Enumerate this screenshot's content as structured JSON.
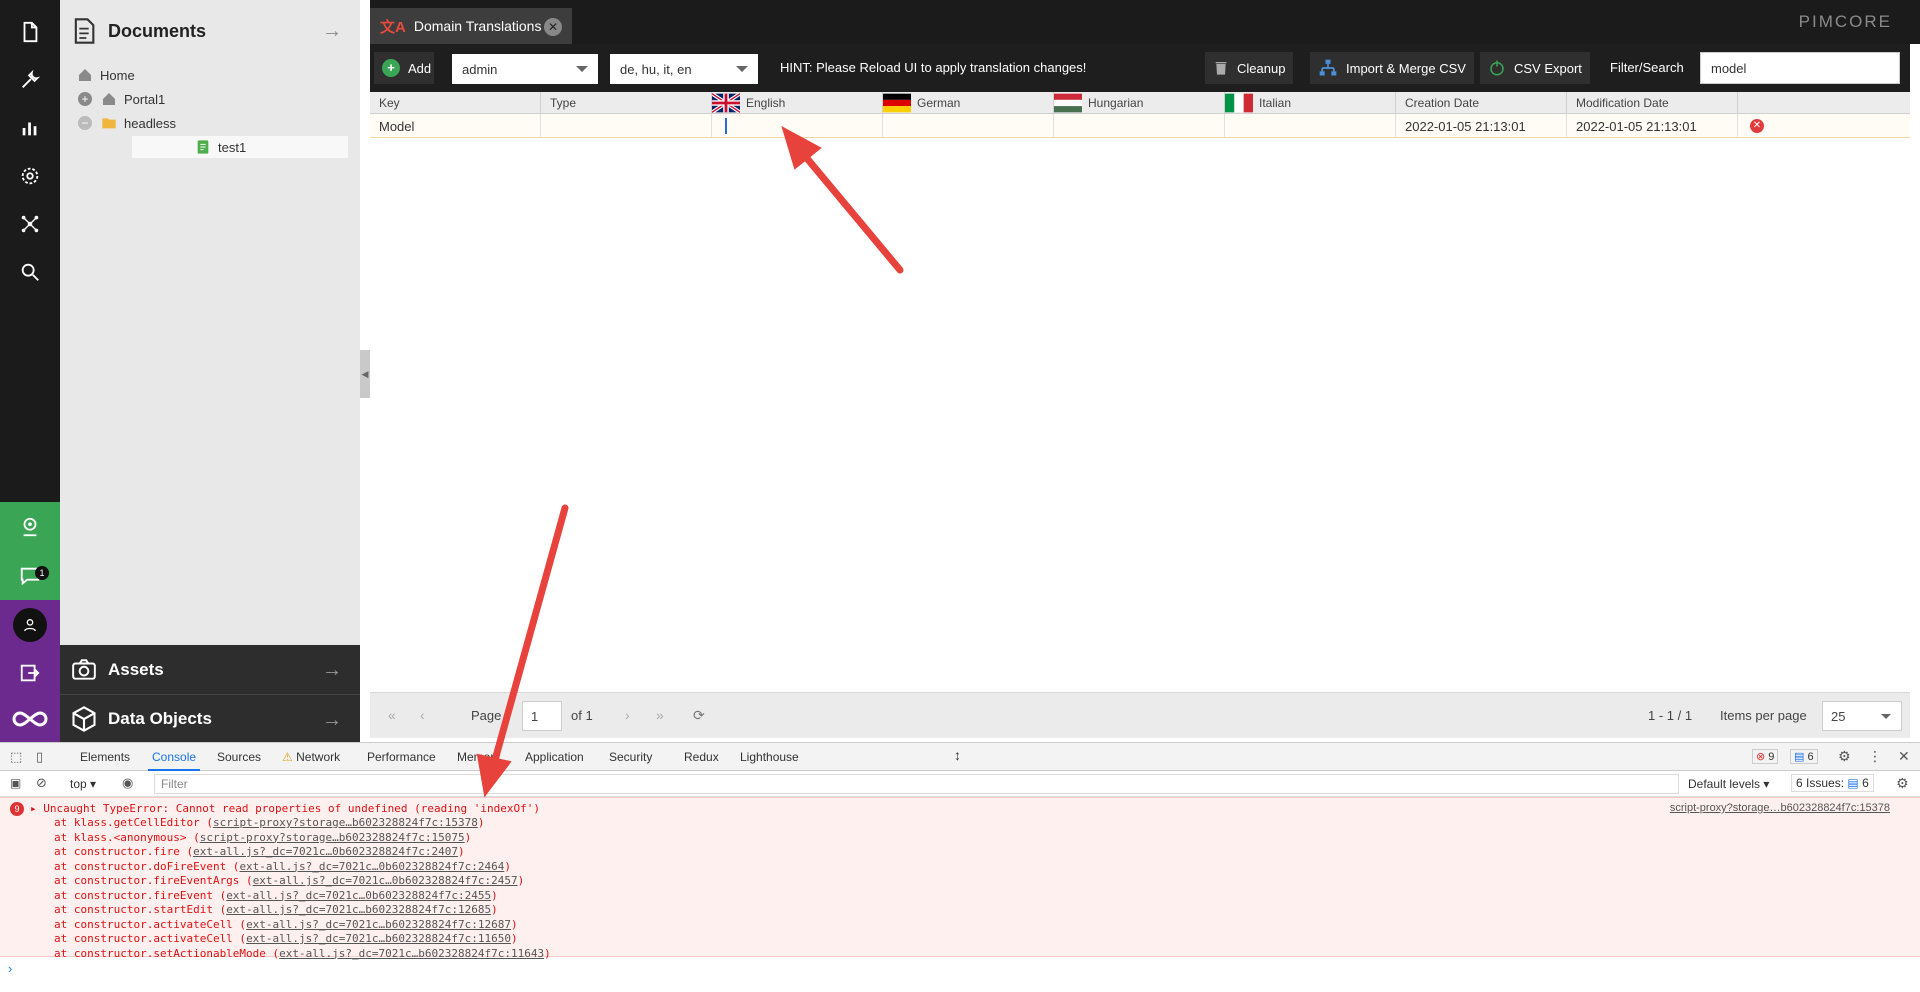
{
  "documents_panel": {
    "title": "Documents",
    "tree": [
      {
        "label": "Home"
      },
      {
        "label": "Portal1"
      },
      {
        "label": "headless"
      },
      {
        "label": "test1"
      }
    ]
  },
  "side_tabs": {
    "assets": "Assets",
    "data_objects": "Data Objects"
  },
  "iconbar": {
    "chat_badge": "1"
  },
  "tab": {
    "label": "Domain Translations"
  },
  "brand": {
    "logo": "PIMCORE"
  },
  "toolbar": {
    "add": "Add",
    "domain_value": "admin",
    "languages_value": "de, hu, it, en",
    "hint": "HINT: Please Reload UI to apply translation changes!",
    "cleanup": "Cleanup",
    "import": "Import & Merge CSV",
    "export": "CSV Export",
    "filter_label": "Filter/Search",
    "filter_value": "model"
  },
  "grid": {
    "columns": [
      "Key",
      "Type",
      "English",
      "German",
      "Hungarian",
      "Italian",
      "Creation Date",
      "Modification Date"
    ],
    "rows": [
      {
        "key": "Model",
        "type": "",
        "english": "",
        "german": "",
        "hungarian": "",
        "italian": "",
        "creation": "2022-01-05 21:13:01",
        "modification": "2022-01-05 21:13:01"
      }
    ]
  },
  "pager": {
    "page_label": "Page",
    "page_value": "1",
    "of": "of 1",
    "range": "1 - 1 / 1",
    "items_label": "Items per page",
    "items_value": "25"
  },
  "devtools": {
    "tabs": [
      "Elements",
      "Console",
      "Sources",
      "Network",
      "Performance",
      "Memory",
      "Application",
      "Security",
      "Redux",
      "Lighthouse"
    ],
    "err_count": "9",
    "msg_count": "6",
    "context": "top",
    "filter_placeholder": "Filter",
    "levels": "Default levels",
    "issues": "6 Issues:",
    "issues_count": "6",
    "error_badge": "9",
    "error_message": "Uncaught TypeError: Cannot read properties of undefined (reading 'indexOf')",
    "error_source": "script-proxy?storage…b602328824f7c:15378",
    "stack": [
      {
        "fn": "at klass.getCellEditor (",
        "loc": "script-proxy?storage…b602328824f7c:15378",
        "end": ")"
      },
      {
        "fn": "at klass.<anonymous> (",
        "loc": "script-proxy?storage…b602328824f7c:15075",
        "end": ")"
      },
      {
        "fn": "at constructor.fire (",
        "loc": "ext-all.js?_dc=7021c…0b602328824f7c:2407",
        "end": ")"
      },
      {
        "fn": "at constructor.doFireEvent (",
        "loc": "ext-all.js?_dc=7021c…0b602328824f7c:2464",
        "end": ")"
      },
      {
        "fn": "at constructor.fireEventArgs (",
        "loc": "ext-all.js?_dc=7021c…0b602328824f7c:2457",
        "end": ")"
      },
      {
        "fn": "at constructor.fireEvent (",
        "loc": "ext-all.js?_dc=7021c…0b602328824f7c:2455",
        "end": ")"
      },
      {
        "fn": "at constructor.startEdit (",
        "loc": "ext-all.js?_dc=7021c…b602328824f7c:12685",
        "end": ")"
      },
      {
        "fn": "at constructor.activateCell (",
        "loc": "ext-all.js?_dc=7021c…b602328824f7c:12687",
        "end": ")"
      },
      {
        "fn": "at constructor.activateCell (",
        "loc": "ext-all.js?_dc=7021c…b602328824f7c:11650",
        "end": ")"
      },
      {
        "fn": "at constructor.setActionableMode (",
        "loc": "ext-all.js?_dc=7021c…b602328824f7c:11643",
        "end": ")"
      }
    ]
  },
  "colors": {
    "dark": "#1b1b1b",
    "green": "#3aa555",
    "purple": "#6c2a8f",
    "arrow": "#e8423c",
    "error_bg": "#fff0f0"
  }
}
